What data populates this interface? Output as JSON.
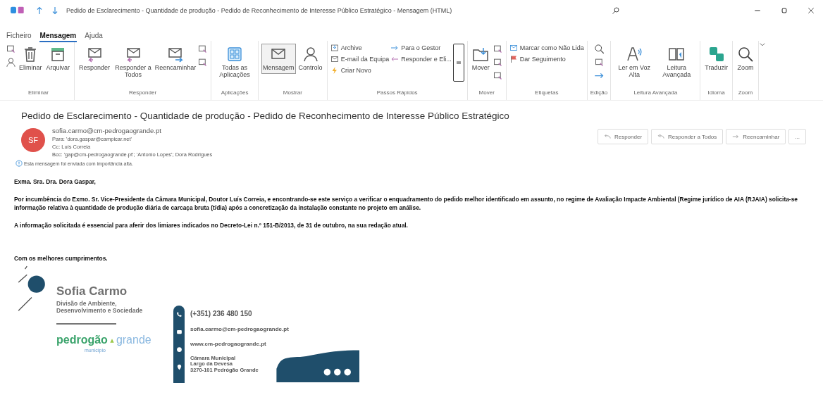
{
  "window": {
    "title": "Pedido de Esclarecimento - Quantidade de produção - Pedido de Reconhecimento de Interesse Público Estratégico  -  Mensagem (HTML)"
  },
  "menu_tabs": [
    {
      "label": "Ficheiro",
      "selected": false
    },
    {
      "label": "Mensagem",
      "selected": true
    },
    {
      "label": "Ajuda",
      "selected": false
    }
  ],
  "ribbon_groups": [
    {
      "label": "Eliminar",
      "items": [
        {
          "kind": "iconstack"
        },
        {
          "kind": "large",
          "label": "Eliminar"
        },
        {
          "kind": "large",
          "label": "Arquivar"
        }
      ]
    },
    {
      "label": "Responder",
      "items": [
        {
          "kind": "large",
          "label": "Responder"
        },
        {
          "kind": "large",
          "label": "Responder a Todos"
        },
        {
          "kind": "large",
          "label": "Reencaminhar"
        },
        {
          "kind": "iconstack"
        }
      ]
    },
    {
      "label": "Aplicações",
      "items": [
        {
          "kind": "large",
          "label": "Todas as Aplicações"
        }
      ]
    },
    {
      "label": "Mostrar",
      "items": [
        {
          "kind": "large",
          "label": "Mensagem",
          "selected": true
        },
        {
          "kind": "large",
          "label": "Controlo",
          "selected": false
        }
      ]
    },
    {
      "label": "Passos Rápidos",
      "items": [
        {
          "kind": "column",
          "items": [
            "Archive",
            "E-mail da Equipa",
            "Criar Novo"
          ]
        },
        {
          "kind": "column",
          "items": [
            "Para o Gestor",
            "Responder e Eli..."
          ]
        },
        {
          "kind": "gallery"
        }
      ]
    },
    {
      "label": "Mover",
      "items": [
        {
          "kind": "large",
          "label": "Mover"
        },
        {
          "kind": "iconstack"
        }
      ]
    },
    {
      "label": "Etiquetas",
      "items": [
        {
          "kind": "column",
          "items": [
            "Marcar como Não Lida",
            "Dar Seguimento"
          ]
        }
      ]
    },
    {
      "label": "Edição",
      "items": [
        {
          "kind": "iconstack"
        }
      ]
    },
    {
      "label": "Leitura Avançada",
      "items": [
        {
          "kind": "large",
          "label": "Ler em Voz Alta"
        },
        {
          "kind": "large",
          "label": "Leitura Avançada"
        }
      ]
    },
    {
      "label": "Idioma",
      "items": [
        {
          "kind": "large",
          "label": "Traduzir"
        }
      ]
    },
    {
      "label": "Zoom",
      "items": [
        {
          "kind": "large",
          "label": "Zoom"
        }
      ]
    }
  ],
  "message": {
    "subject": "Pedido de Esclarecimento - Quantidade de produção - Pedido de Reconhecimento de Interesse Público Estratégico",
    "avatar": {
      "initials": "SF",
      "color": "#e0514b"
    },
    "from": "sofia.carmo@cm-pedrogaogrande.pt",
    "to_label": "Para:",
    "to": "'dora.gaspar@campicar.net'",
    "cc_label": "Cc:",
    "cc": "Luís Correia",
    "bcc_label": "Bcc:",
    "bcc": "'gap@cm-pedrogaogrande.pt'; 'Antonio Lopes'; Dora Rodrigues",
    "importance_note": "Esta mensagem foi enviada com importância alta.",
    "actions": [
      "Responder",
      "Responder a Todos",
      "Reencaminhar",
      "..."
    ]
  },
  "body": {
    "paragraphs": [
      "Exma. Sra. Dra. Dora Gaspar,",
      "Por incumbência do Exmo. Sr. Vice-Presidente da Câmara Municipal, Doutor Luís Correia, e encontrando-se este serviço a verificar o enquadramento do pedido melhor identificado em assunto, no regime de Avaliação Impacte Ambiental (Regime jurídico de AIA (RJAIA) solicita-se informação relativa à quantidade de produção diária de carcaça bruta (t/dia) após a concretização da instalação constante no projeto em análise.",
      "A informação solicitada é essencial para aferir dos limiares indicados no Decreto-Lei n.º 151-B/2013, de 31 de outubro, na sua redação atual."
    ],
    "closing": "Com os melhores cumprimentos."
  },
  "signature": {
    "name": "Sofia Carmo",
    "division": [
      "Divisão de Ambiente,",
      "Desenvolvimento e Sociedade"
    ],
    "logo_left": "pedrogão",
    "logo_right": "grande",
    "logo_sub": "município",
    "phone": "(+351) 236 480 150",
    "email": "sofia.carmo@cm-pedrogaogrande.pt",
    "web": "www.cm-pedrogaogrande.pt",
    "address": [
      "Câmara Municipal",
      "Largo da Devesa",
      "3270-101 Pedrógão Grande"
    ]
  }
}
